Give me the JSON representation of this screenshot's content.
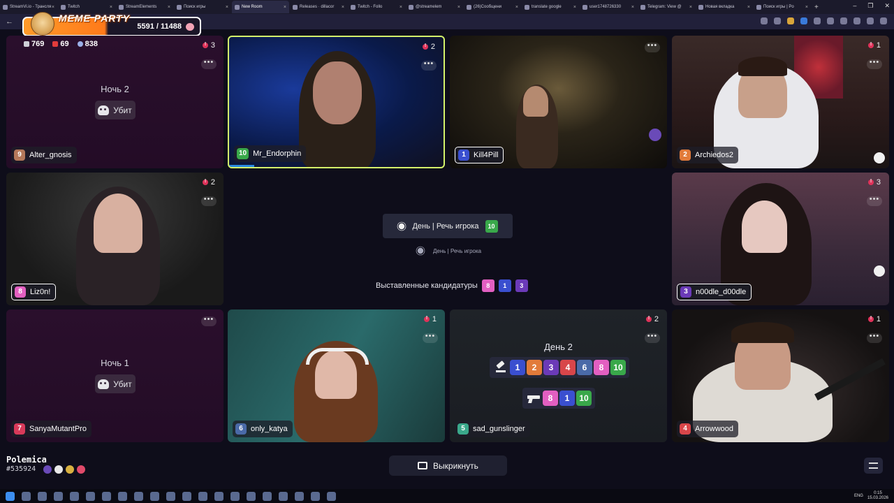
{
  "browser": {
    "tabs": [
      {
        "label": "StreamVi.io - Трансля",
        "active": false
      },
      {
        "label": "Twitch",
        "active": false
      },
      {
        "label": "StreamElements",
        "active": false
      },
      {
        "label": "Поиск игры",
        "active": false
      },
      {
        "label": "New Room",
        "active": true
      },
      {
        "label": "Releases · dillacor",
        "active": false
      },
      {
        "label": "Twitch - Follo",
        "active": false
      },
      {
        "label": "@streamelem",
        "active": false
      },
      {
        "label": "(26)Сообщени",
        "active": false
      },
      {
        "label": "translate google",
        "active": false
      },
      {
        "label": "user1748726330",
        "active": false
      },
      {
        "label": "Telegram: View @",
        "active": false
      },
      {
        "label": "Новая вкладка",
        "active": false
      },
      {
        "label": "Поиск игры | Po",
        "active": false
      }
    ]
  },
  "overlay": {
    "title": "MEME PARTY",
    "count": "5591 / 11488"
  },
  "stats": {
    "chat": "769",
    "live": "69",
    "viewers": "838"
  },
  "tiles": [
    {
      "num": "9",
      "name": "Alter_gnosis",
      "color": "#b5785a",
      "warn": "3",
      "type": "night",
      "night_label": "Ночь 2",
      "killed_label": "Убит"
    },
    {
      "num": "10",
      "name": "Mr_Endorphin",
      "color": "#39a84a",
      "warn": "2",
      "type": "cam"
    },
    {
      "num": "1",
      "name": "Kill4Pill",
      "color": "#3a4fd0",
      "warn": "",
      "type": "cam"
    },
    {
      "num": "2",
      "name": "Archiedos2",
      "color": "#e27b3a",
      "warn": "1",
      "type": "cam"
    },
    {
      "num": "8",
      "name": "Liz0n!",
      "color": "#e25fc1",
      "warn": "2",
      "type": "cam"
    },
    {
      "num": "3",
      "name": "n00dle_d00dle",
      "color": "#6b3ab8",
      "warn": "3",
      "type": "cam"
    },
    {
      "num": "7",
      "name": "SanyaMutantPro",
      "color": "#d83a5a",
      "warn": "",
      "type": "night",
      "night_label": "Ночь 1",
      "killed_label": "Убит"
    },
    {
      "num": "6",
      "name": "only_katya",
      "color": "#4a6aa8",
      "warn": "1",
      "type": "cam"
    },
    {
      "num": "5",
      "name": "sad_gunslinger",
      "color": "#3aa88a",
      "warn": "2",
      "type": "day"
    },
    {
      "num": "4",
      "name": "Arrowwood",
      "color": "#d8464a",
      "warn": "1",
      "type": "cam"
    }
  ],
  "day_tile": {
    "title": "День 2",
    "vote_row": [
      {
        "n": "1",
        "color": "#3a4fd0"
      },
      {
        "n": "2",
        "color": "#e27b3a"
      },
      {
        "n": "3",
        "color": "#6b3ab8"
      },
      {
        "n": "4",
        "color": "#d8464a"
      },
      {
        "n": "6",
        "color": "#4a6aa8"
      },
      {
        "n": "8",
        "color": "#e25fc1"
      },
      {
        "n": "10",
        "color": "#39a84a"
      }
    ],
    "shot_row": [
      {
        "n": "8",
        "color": "#e25fc1"
      },
      {
        "n": "1",
        "color": "#3a4fd0"
      },
      {
        "n": "10",
        "color": "#39a84a"
      }
    ]
  },
  "center": {
    "phase": "День | Речь игрока",
    "phase_player": "10",
    "phase_player_color": "#39a84a",
    "phase_small": "День | Речь игрока",
    "candidates_label": "Выставленные кандидатуры",
    "candidates": [
      {
        "n": "8",
        "color": "#e25fc1"
      },
      {
        "n": "1",
        "color": "#3a4fd0"
      },
      {
        "n": "3",
        "color": "#6b3ab8"
      }
    ]
  },
  "bottom": {
    "room_name": "Polemica",
    "room_id": "#535924",
    "kick_label": "Выкрикнуть"
  },
  "taskbar": {
    "lang": "ENG",
    "time": "0:15",
    "date": "15.03.2026"
  },
  "icons": [
    "search-icon",
    "back-arrow-icon",
    "skull-icon",
    "sun-icon",
    "gavel-icon",
    "gun-icon",
    "more-dots-icon",
    "warning-icon",
    "megaphone-icon",
    "settings-icon",
    "windows-icon"
  ]
}
